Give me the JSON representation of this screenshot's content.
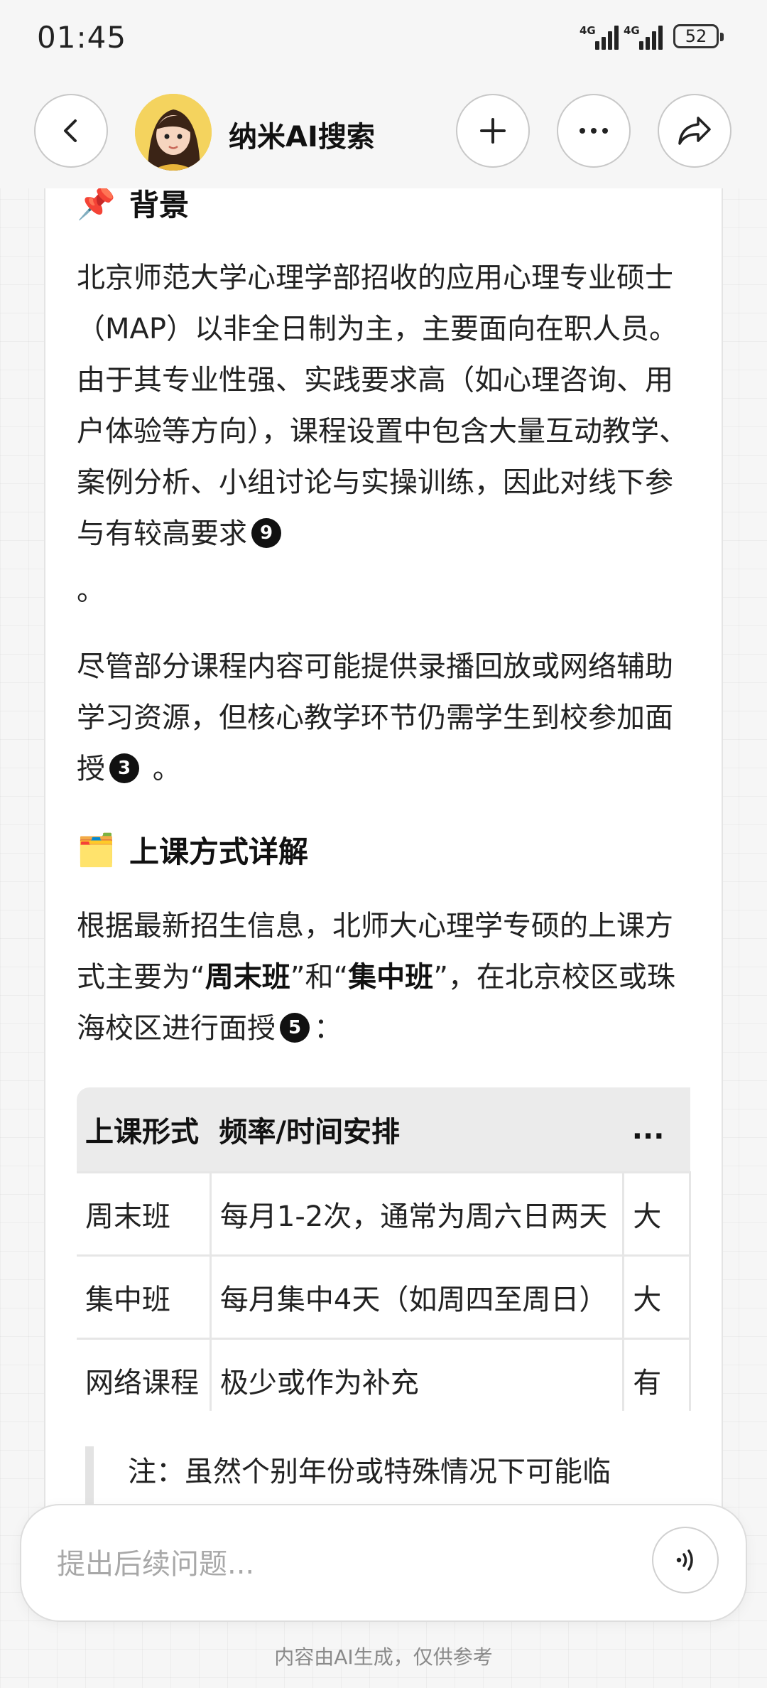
{
  "status_bar": {
    "time": "01:45",
    "signal1_label": "4G",
    "signal2_label": "4G",
    "battery": "52"
  },
  "header": {
    "title": "纳米AI搜索",
    "icons": [
      "back-icon",
      "plus-icon",
      "more-icon",
      "share-icon"
    ]
  },
  "sections": {
    "background": {
      "emoji": "📌",
      "title": "背景",
      "para1": "北京师范大学心理学部招收的应用心理专业硕士（MAP）以非全日制为主，主要面向在职人员。由于其专业性强、实践要求高（如心理咨询、用户体验等方向），课程设置中包含大量互动教学、案例分析、小组讨论与实操训练，因此对线下参与有较高要求",
      "para1_cite": "9",
      "para1_tail": "。",
      "para2": "尽管部分课程内容可能提供录播回放或网络辅助学习资源，但核心教学环节仍需学生到校参加面授",
      "para2_cite": "3",
      "para2_tail": " 。"
    },
    "methods": {
      "emoji": "🗂️",
      "title": "上课方式详解",
      "para_a": "根据最新招生信息，北师大心理学专硕的上课方式主要为“",
      "bold1": "周末班",
      "para_b": "”和“",
      "bold2": "集中班",
      "para_c": "”，在北京校区或珠海校区进行面授",
      "cite": "5",
      "para_d": "："
    }
  },
  "table": {
    "headers": [
      "上课形式",
      "频率/时间安排",
      "..."
    ],
    "rows": [
      [
        "周末班",
        "每月1-2次，通常为周六日两天",
        "大"
      ],
      [
        "集中班",
        "每月集中4天（如周四至周日）",
        "大"
      ],
      [
        "网络课程",
        "极少或作为补充",
        "有"
      ]
    ]
  },
  "note": "注：虽然个别年份或特殊情况下可能临",
  "input": {
    "placeholder": "提出后续问题..."
  },
  "footer": "内容由AI生成，仅供参考"
}
